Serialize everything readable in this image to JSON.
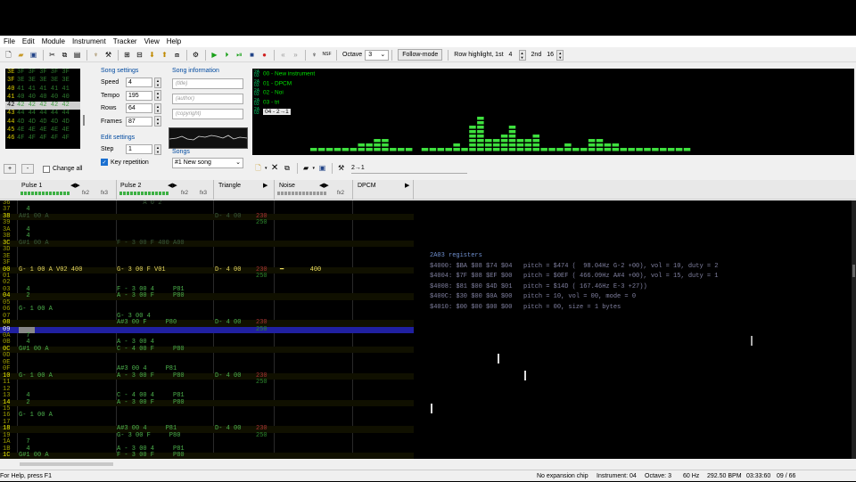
{
  "menubar": [
    "File",
    "Edit",
    "Module",
    "Instrument",
    "Tracker",
    "View",
    "Help"
  ],
  "toolbar": {
    "octave_label": "Octave",
    "octave_value": "3",
    "follow_mode": "Follow-mode",
    "row_highlight_label": "Row highlight, 1st",
    "row_highlight_1st": "4",
    "second_label": "2nd",
    "row_highlight_2nd": "16"
  },
  "instrument_panel": {
    "rows": [
      {
        "num": "3E",
        "vals": "3F 3F 3F 3F 3F"
      },
      {
        "num": "3F",
        "vals": "3E 3E 3E 3E 3E"
      },
      {
        "num": "40",
        "vals": "41 41 41 41 41"
      },
      {
        "num": "41",
        "vals": "40 40 40 40 40"
      },
      {
        "num": "42",
        "vals": "42 42 42 42 42"
      },
      {
        "num": "43",
        "vals": "44 44 44 44 44"
      },
      {
        "num": "44",
        "vals": "4D 4D 4D 4D 4D"
      },
      {
        "num": "45",
        "vals": "4E 4E 4E 4E 4E"
      },
      {
        "num": "46",
        "vals": "4F 4F 4F 4F 4F"
      }
    ],
    "add_button": "+",
    "remove_button": "-",
    "change_all_label": "Change all"
  },
  "song_settings": {
    "title": "Song settings",
    "fields": [
      {
        "label": "Speed",
        "value": "4"
      },
      {
        "label": "Tempo",
        "value": "195"
      },
      {
        "label": "Rows",
        "value": "64"
      },
      {
        "label": "Frames",
        "value": "87"
      }
    ]
  },
  "edit_settings": {
    "title": "Edit settings",
    "step_label": "Step",
    "step_value": "1",
    "key_repetition": "Key repetition"
  },
  "song_information": {
    "title": "Song information",
    "title_field": "(title)",
    "author_field": "(author)",
    "copyright_field": "(copyright)"
  },
  "songs": {
    "label": "Songs",
    "selected": "#1 New song"
  },
  "instrument_list": [
    {
      "id": "00",
      "name": "00 - New instrument"
    },
    {
      "id": "01",
      "name": "01 - DPCM"
    },
    {
      "id": "02",
      "name": "02 - Noi"
    },
    {
      "id": "03",
      "name": "03 - tri"
    },
    {
      "id": "04",
      "name": "04 - 2→1"
    }
  ],
  "spectrum": [
    {
      "x": 0.3,
      "h": 0
    },
    {
      "x": 0.36,
      "h": 1
    },
    {
      "x": 0.38,
      "h": 1
    },
    {
      "x": 0.4,
      "h": 1
    },
    {
      "x": 0.42,
      "h": 1
    },
    {
      "x": 0.44,
      "h": 1
    },
    {
      "x": 0.46,
      "h": 1
    },
    {
      "x": 0.48,
      "h": 2
    },
    {
      "x": 0.5,
      "h": 2
    },
    {
      "x": 0.52,
      "h": 2
    },
    {
      "x": 0.54,
      "h": 1
    },
    {
      "x": 0.56,
      "h": 1
    },
    {
      "x": 0.58,
      "h": 1
    },
    {
      "x": 0.6,
      "h": 1
    },
    {
      "x": 0.62,
      "h": 1
    }
  ],
  "spectrum_bars": [
    1,
    1,
    1,
    1,
    1,
    1,
    2,
    2,
    3,
    3,
    1,
    1,
    1,
    0,
    1,
    1,
    1,
    1,
    2,
    1,
    6,
    8,
    3,
    3,
    4,
    6,
    3,
    3,
    4,
    1,
    1,
    1,
    2,
    1,
    1,
    3,
    3,
    2,
    2,
    1,
    1,
    1,
    1,
    1,
    1,
    1,
    1,
    1
  ],
  "instrument_editor_name": "2→1",
  "channels": [
    {
      "name": "Pulse 1",
      "fx": [
        "fx2",
        "fx3"
      ]
    },
    {
      "name": "Pulse 2",
      "fx": [
        "fx2",
        "fx3"
      ]
    },
    {
      "name": "Triangle",
      "fx": []
    },
    {
      "name": "Noise",
      "fx": [
        "fx2"
      ]
    },
    {
      "name": "DPCM",
      "fx": []
    }
  ],
  "pattern_rows": [
    {
      "row": "36",
      "p1": "",
      "p2": "       A 0 2",
      "tr": "",
      "tr_v": "",
      "ns": "",
      "hl": false,
      "dim": true
    },
    {
      "row": "37",
      "p1": "  4",
      "p2": "",
      "tr": "",
      "tr_v": "",
      "ns": "",
      "hl": false
    },
    {
      "row": "38",
      "p1": "A#1 00 A",
      "p2": "",
      "tr": "D- 4 00",
      "tr_v": "230",
      "ns": "",
      "hl": true,
      "dim": true
    },
    {
      "row": "39",
      "p1": "",
      "p2": "",
      "tr": "",
      "tr_v": "250",
      "ns": "",
      "hl": false
    },
    {
      "row": "3A",
      "p1": "  4",
      "p2": "",
      "tr": "",
      "tr_v": "",
      "ns": "",
      "hl": false
    },
    {
      "row": "3B",
      "p1": "  4",
      "p2": "",
      "tr": "",
      "tr_v": "",
      "ns": "",
      "hl": false
    },
    {
      "row": "3C",
      "p1": "G#1 00 A",
      "p2": "F - 3 00 F 400 A00",
      "tr": "",
      "tr_v": "",
      "ns": "",
      "hl": true,
      "dim": true
    },
    {
      "row": "3D",
      "p1": "",
      "p2": "",
      "tr": "",
      "tr_v": "",
      "ns": "",
      "hl": false
    },
    {
      "row": "3E",
      "p1": "",
      "p2": "",
      "tr": "",
      "tr_v": "",
      "ns": "",
      "hl": false
    },
    {
      "row": "3F",
      "p1": "",
      "p2": "",
      "tr": "",
      "tr_v": "",
      "ns": "",
      "hl": false
    },
    {
      "row": "00",
      "p1": "G- 1 00 A V02 400",
      "p2": "G- 3 00 F V01",
      "tr": "D- 4 00",
      "tr_v": "230",
      "ns": "━       400",
      "hl": true,
      "bright": true
    },
    {
      "row": "01",
      "p1": "",
      "p2": "",
      "tr": "",
      "tr_v": "250",
      "ns": "",
      "hl": false
    },
    {
      "row": "02",
      "p1": "",
      "p2": "",
      "tr": "",
      "tr_v": "",
      "ns": "",
      "hl": false
    },
    {
      "row": "03",
      "p1": "  4",
      "p2": "F - 3 00 4     P81",
      "tr": "",
      "tr_v": "",
      "ns": "",
      "hl": false
    },
    {
      "row": "04",
      "p1": "  2",
      "p2": "A - 3 00 F     P80",
      "tr": "",
      "tr_v": "",
      "ns": "",
      "hl": true
    },
    {
      "row": "05",
      "p1": "",
      "p2": "",
      "tr": "",
      "tr_v": "",
      "ns": "",
      "hl": false
    },
    {
      "row": "06",
      "p1": "G- 1 00 A",
      "p2": "",
      "tr": "",
      "tr_v": "",
      "ns": "",
      "hl": false
    },
    {
      "row": "07",
      "p1": "",
      "p2": "G- 3 00 4",
      "tr": "",
      "tr_v": "",
      "ns": "",
      "hl": false
    },
    {
      "row": "08",
      "p1": "",
      "p2": "A#3 00 F     P80",
      "tr": "D- 4 00",
      "tr_v": "230",
      "ns": "",
      "hl": true
    },
    {
      "row": "09",
      "p1": "",
      "p2": "",
      "tr": "",
      "tr_v": "250",
      "ns": "",
      "hl": false,
      "cur": true
    },
    {
      "row": "0A",
      "p1": "  7",
      "p2": "",
      "tr": "",
      "tr_v": "",
      "ns": "",
      "hl": false
    },
    {
      "row": "0B",
      "p1": "  4",
      "p2": "A - 3 00 4",
      "tr": "",
      "tr_v": "",
      "ns": "",
      "hl": false
    },
    {
      "row": "0C",
      "p1": "G#1 00 A",
      "p2": "C - 4 00 F     P80",
      "tr": "",
      "tr_v": "",
      "ns": "",
      "hl": true
    },
    {
      "row": "0D",
      "p1": "",
      "p2": "",
      "tr": "",
      "tr_v": "",
      "ns": "",
      "hl": false
    },
    {
      "row": "0E",
      "p1": "",
      "p2": "",
      "tr": "",
      "tr_v": "",
      "ns": "",
      "hl": false
    },
    {
      "row": "0F",
      "p1": "",
      "p2": "A#3 00 4     P81",
      "tr": "",
      "tr_v": "",
      "ns": "",
      "hl": false
    },
    {
      "row": "10",
      "p1": "G- 1 00 A",
      "p2": "A - 3 00 F     P80",
      "tr": "D- 4 00",
      "tr_v": "230",
      "ns": "",
      "hl": true
    },
    {
      "row": "11",
      "p1": "",
      "p2": "",
      "tr": "",
      "tr_v": "250",
      "ns": "",
      "hl": false
    },
    {
      "row": "12",
      "p1": "",
      "p2": "",
      "tr": "",
      "tr_v": "",
      "ns": "",
      "hl": false
    },
    {
      "row": "13",
      "p1": "  4",
      "p2": "C - 4 00 4     P81",
      "tr": "",
      "tr_v": "",
      "ns": "",
      "hl": false
    },
    {
      "row": "14",
      "p1": "  2",
      "p2": "A - 3 00 F     P80",
      "tr": "",
      "tr_v": "",
      "ns": "",
      "hl": true
    },
    {
      "row": "15",
      "p1": "",
      "p2": "",
      "tr": "",
      "tr_v": "",
      "ns": "",
      "hl": false
    },
    {
      "row": "16",
      "p1": "G- 1 00 A",
      "p2": "",
      "tr": "",
      "tr_v": "",
      "ns": "",
      "hl": false
    },
    {
      "row": "17",
      "p1": "",
      "p2": "",
      "tr": "",
      "tr_v": "",
      "ns": "",
      "hl": false
    },
    {
      "row": "18",
      "p1": "",
      "p2": "A#3 00 4     P81",
      "tr": "D- 4 00",
      "tr_v": "230",
      "ns": "",
      "hl": true
    },
    {
      "row": "19",
      "p1": "",
      "p2": "G- 3 00 F     P80",
      "tr": "",
      "tr_v": "250",
      "ns": "",
      "hl": false
    },
    {
      "row": "1A",
      "p1": "  7",
      "p2": "",
      "tr": "",
      "tr_v": "",
      "ns": "",
      "hl": false
    },
    {
      "row": "1B",
      "p1": "  4",
      "p2": "A - 3 00 4     P81",
      "tr": "",
      "tr_v": "",
      "ns": "",
      "hl": false
    },
    {
      "row": "1C",
      "p1": "G#1 00 A",
      "p2": "F - 3 00 F     P80",
      "tr": "",
      "tr_v": "",
      "ns": "",
      "hl": true
    }
  ],
  "registers": {
    "title": "2A03 registers",
    "lines": [
      "$4000: $BA $08 $74 $04   pitch = $474 (  98.04Hz G-2 +00), vol = 10, duty = 2",
      "$4004: $7F $08 $EF $00   pitch = $0EF ( 466.09Hz A#4 +00), vol = 15, duty = 1",
      "$4008: $81 $00 $4D $01   pitch = $14D ( 167.46Hz E-3 +27))",
      "$400C: $30 $00 $0A $00   pitch = 10, vol = 00, mode = 0",
      "$4010: $00 $00 $00 $00   pitch = 00, size = 1 bytes"
    ]
  },
  "statusbar": {
    "help": "For Help, press F1",
    "chip": "No expansion chip",
    "instrument": "Instrument: 04",
    "octave": "Octave: 3",
    "rate": "60 Hz",
    "bpm": "292.50 BPM",
    "time": "03:33:60",
    "position": "09 / 66"
  },
  "colors": {
    "accent": "#1a6fd0",
    "note": "#4db34d",
    "highlight": "#f0f000",
    "cursor": "#2020a0"
  }
}
